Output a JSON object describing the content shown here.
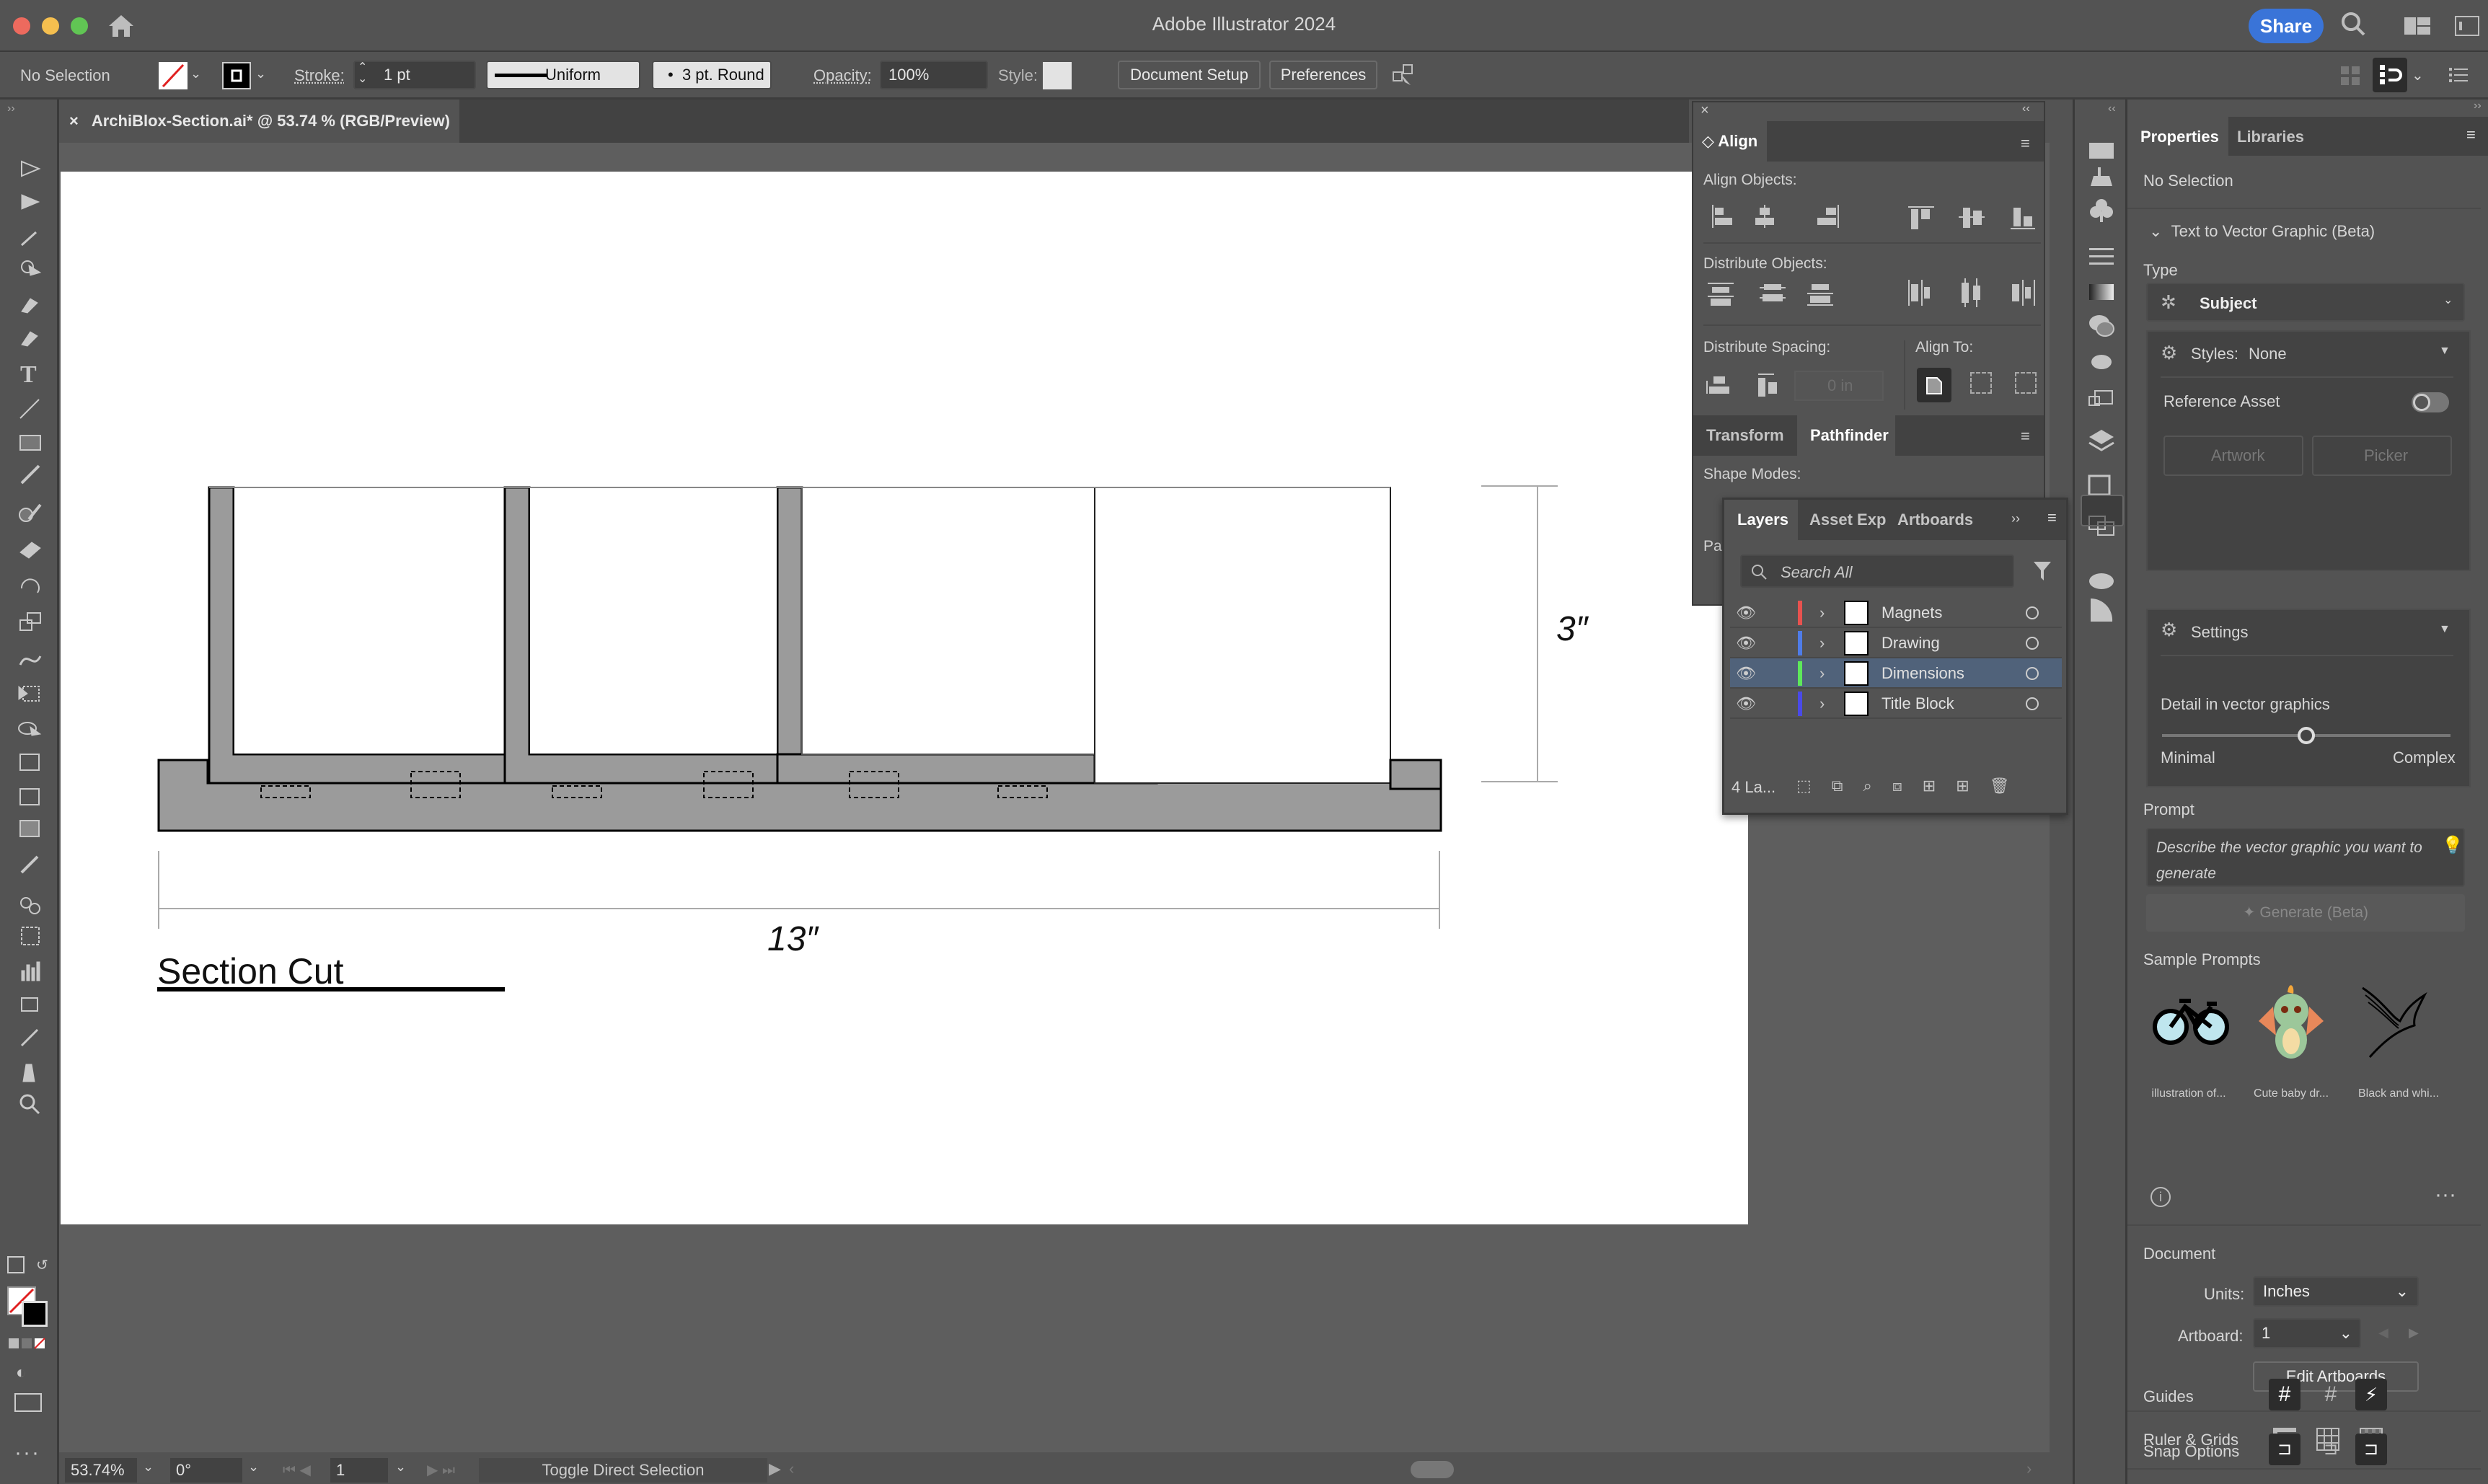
{
  "window": {
    "title": "Adobe Illustrator 2024",
    "share_label": "Share",
    "traffic_colors": {
      "close": "#ed6a5e",
      "minimize": "#f5bf4f",
      "maximize": "#61c554"
    }
  },
  "control_bar": {
    "selection_status": "No Selection",
    "stroke_label": "Stroke:",
    "stroke_weight": "1 pt",
    "stroke_profile": "Uniform",
    "brush": "3 pt. Round",
    "opacity_label": "Opacity:",
    "opacity_value": "100%",
    "style_label": "Style:",
    "document_setup_label": "Document Setup",
    "preferences_label": "Preferences"
  },
  "document": {
    "tab_title": "ArchiBlox-Section.ai* @ 53.74 % (RGB/Preview)",
    "drawing": {
      "height_dimension": "3″",
      "width_dimension": "13″",
      "title": "Section Cut"
    }
  },
  "status_bar": {
    "zoom": "53.74%",
    "rotation": "0°",
    "artboard": "1",
    "tool_hint": "Toggle Direct Selection"
  },
  "align_panel": {
    "tab": "Align",
    "align_objects_label": "Align Objects:",
    "distribute_objects_label": "Distribute Objects:",
    "distribute_spacing_label": "Distribute Spacing:",
    "spacing_value": "0 in",
    "align_to_label": "Align To:",
    "tabs2": [
      "Transform",
      "Pathfinder"
    ],
    "shape_modes_label": "Shape Modes:",
    "pathfinders_label": "Pat"
  },
  "layers_panel": {
    "tabs": [
      "Layers",
      "Asset Expo",
      "Artboards"
    ],
    "search_placeholder": "Search All",
    "layers": [
      {
        "name": "Magnets",
        "color": "#e8524f",
        "visible": true,
        "selected": false
      },
      {
        "name": "Drawing",
        "color": "#4f7ce8",
        "visible": true,
        "selected": false
      },
      {
        "name": "Dimensions",
        "color": "#5ee85a",
        "visible": true,
        "selected": true
      },
      {
        "name": "Title Block",
        "color": "#4a4ae8",
        "visible": true,
        "selected": false
      }
    ],
    "count_label": "4 La..."
  },
  "properties_panel": {
    "tabs": [
      "Properties",
      "Libraries"
    ],
    "selection": "No Selection",
    "t2v_title": "Text to Vector Graphic (Beta)",
    "type_label": "Type",
    "type_value": "Subject",
    "styles_label": "Styles:",
    "styles_value": "None",
    "reference_asset_label": "Reference Asset",
    "reference_asset_on": false,
    "artwork_label": "Artwork",
    "picker_label": "Picker",
    "settings_label": "Settings",
    "detail_label": "Detail in vector graphics",
    "detail_min": "Minimal",
    "detail_max": "Complex",
    "detail_value": 0.5,
    "prompt_label": "Prompt",
    "prompt_placeholder": "Describe the vector graphic you want to generate",
    "generate_label": "Generate (Beta)",
    "sample_prompts_label": "Sample Prompts",
    "samples": [
      "illustration of...",
      "Cute baby dr...",
      "Black and whi..."
    ],
    "document_label": "Document",
    "units_label": "Units:",
    "units_value": "Inches",
    "artboard_label": "Artboard:",
    "artboard_value": "1",
    "edit_artboards_label": "Edit Artboards",
    "ruler_grids_label": "Ruler & Grids",
    "guides_label": "Guides",
    "snap_options_label": "Snap Options"
  }
}
